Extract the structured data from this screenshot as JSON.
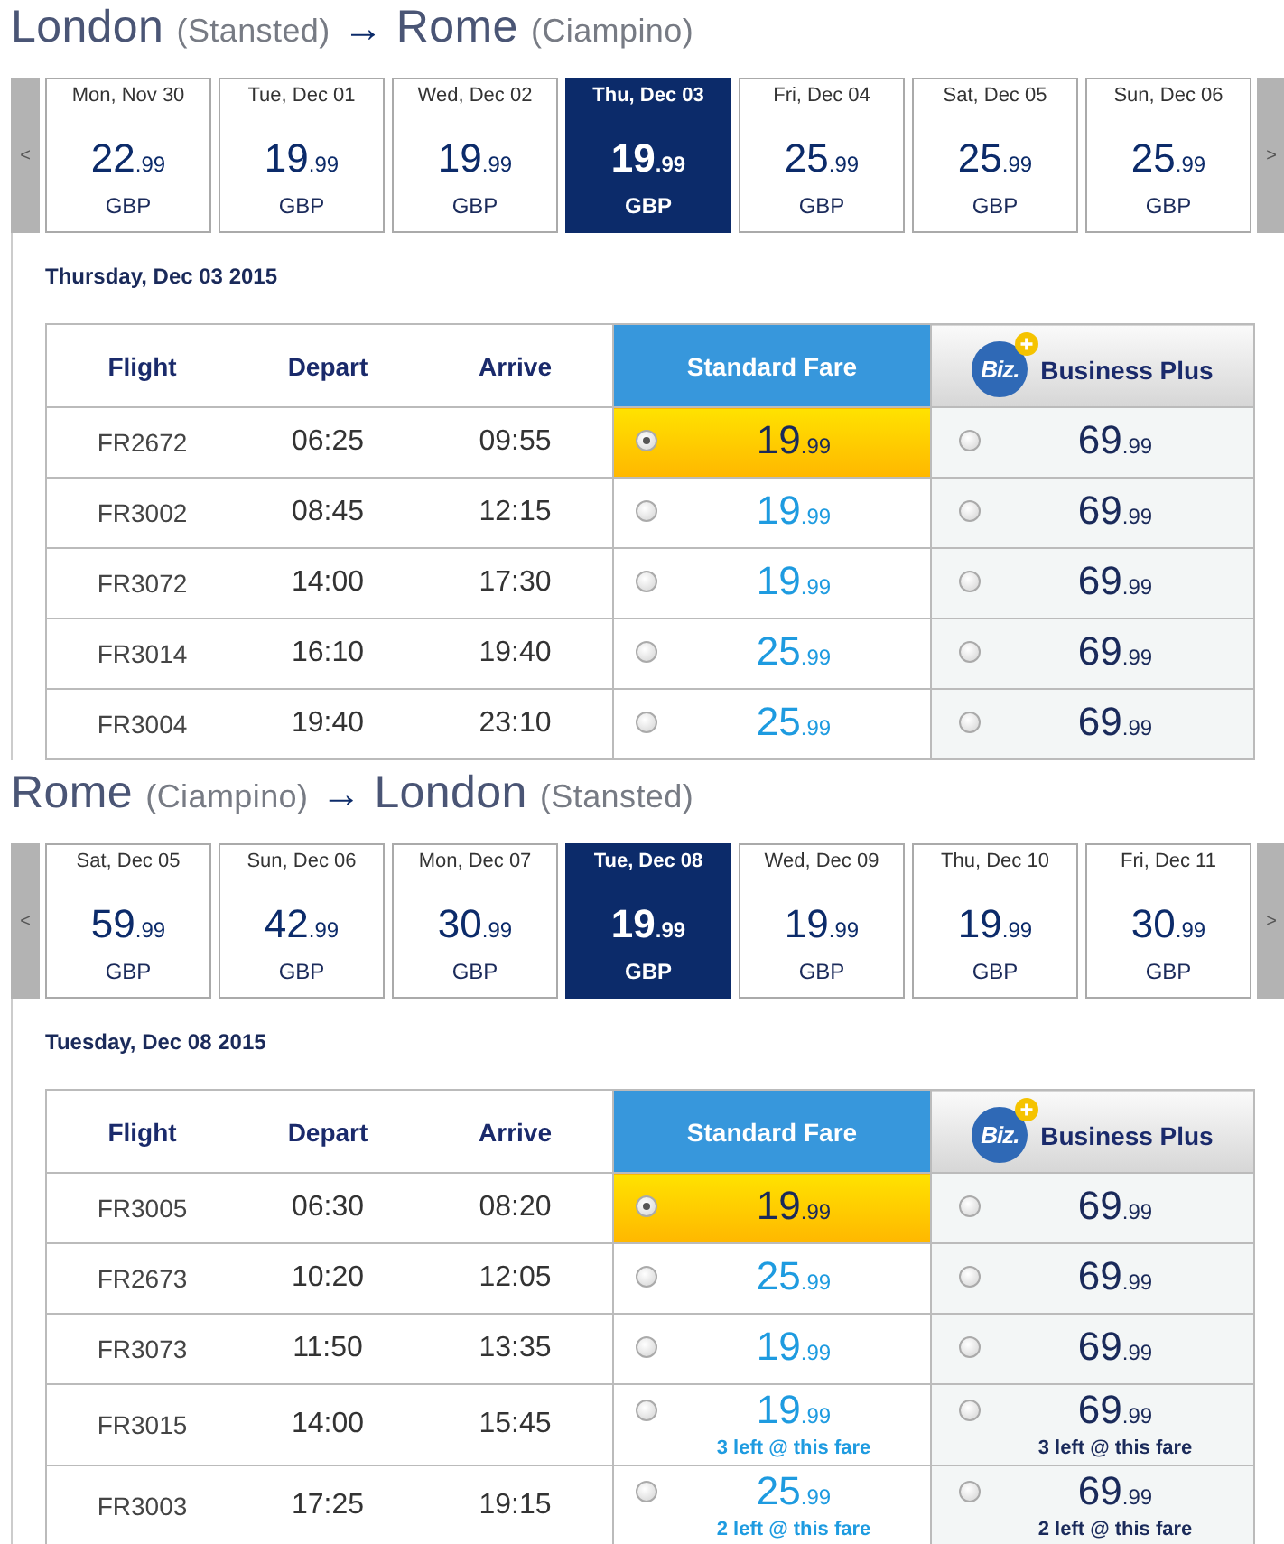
{
  "journeys": [
    {
      "route": {
        "origin": "London",
        "origin_airport": "(Stansted)",
        "arrow": "→",
        "destination": "Rome",
        "destination_airport": "(Ciampino)"
      },
      "date_strip": {
        "prev": "<",
        "next": ">",
        "dates": [
          {
            "day": "Mon, Nov 30",
            "price": "22",
            "cents": ".99",
            "currency": "GBP",
            "selected": false
          },
          {
            "day": "Tue, Dec 01",
            "price": "19",
            "cents": ".99",
            "currency": "GBP",
            "selected": false
          },
          {
            "day": "Wed, Dec 02",
            "price": "19",
            "cents": ".99",
            "currency": "GBP",
            "selected": false
          },
          {
            "day": "Thu, Dec 03",
            "price": "19",
            "cents": ".99",
            "currency": "GBP",
            "selected": true
          },
          {
            "day": "Fri, Dec 04",
            "price": "25",
            "cents": ".99",
            "currency": "GBP",
            "selected": false
          },
          {
            "day": "Sat, Dec 05",
            "price": "25",
            "cents": ".99",
            "currency": "GBP",
            "selected": false
          },
          {
            "day": "Sun, Dec 06",
            "price": "25",
            "cents": ".99",
            "currency": "GBP",
            "selected": false
          }
        ]
      },
      "selected_date": "Thursday, Dec 03 2015",
      "table": {
        "columns": [
          {
            "label": "Flight",
            "kind": "plain"
          },
          {
            "label": "Depart",
            "kind": "plain"
          },
          {
            "label": "Arrive",
            "kind": "plain"
          },
          {
            "label": "Standard Fare",
            "kind": "standard"
          },
          {
            "label": "Business Plus",
            "kind": "business",
            "logo": "Biz."
          }
        ],
        "rows": [
          {
            "flight": "FR2672",
            "depart": "06:25",
            "arrive": "09:55",
            "standard": {
              "price": "19",
              "cents": ".99",
              "selected": true
            },
            "business": {
              "price": "69",
              "cents": ".99",
              "selected": false
            }
          },
          {
            "flight": "FR3002",
            "depart": "08:45",
            "arrive": "12:15",
            "standard": {
              "price": "19",
              "cents": ".99",
              "selected": false
            },
            "business": {
              "price": "69",
              "cents": ".99",
              "selected": false
            }
          },
          {
            "flight": "FR3072",
            "depart": "14:00",
            "arrive": "17:30",
            "standard": {
              "price": "19",
              "cents": ".99",
              "selected": false
            },
            "business": {
              "price": "69",
              "cents": ".99",
              "selected": false
            }
          },
          {
            "flight": "FR3014",
            "depart": "16:10",
            "arrive": "19:40",
            "standard": {
              "price": "25",
              "cents": ".99",
              "selected": false
            },
            "business": {
              "price": "69",
              "cents": ".99",
              "selected": false
            }
          },
          {
            "flight": "FR3004",
            "depart": "19:40",
            "arrive": "23:10",
            "standard": {
              "price": "25",
              "cents": ".99",
              "selected": false
            },
            "business": {
              "price": "69",
              "cents": ".99",
              "selected": false
            }
          }
        ]
      }
    },
    {
      "route": {
        "origin": "Rome",
        "origin_airport": "(Ciampino)",
        "arrow": "→",
        "destination": "London",
        "destination_airport": "(Stansted)"
      },
      "date_strip": {
        "prev": "<",
        "next": ">",
        "dates": [
          {
            "day": "Sat, Dec 05",
            "price": "59",
            "cents": ".99",
            "currency": "GBP",
            "selected": false
          },
          {
            "day": "Sun, Dec 06",
            "price": "42",
            "cents": ".99",
            "currency": "GBP",
            "selected": false
          },
          {
            "day": "Mon, Dec 07",
            "price": "30",
            "cents": ".99",
            "currency": "GBP",
            "selected": false
          },
          {
            "day": "Tue, Dec 08",
            "price": "19",
            "cents": ".99",
            "currency": "GBP",
            "selected": true
          },
          {
            "day": "Wed, Dec 09",
            "price": "19",
            "cents": ".99",
            "currency": "GBP",
            "selected": false
          },
          {
            "day": "Thu, Dec 10",
            "price": "19",
            "cents": ".99",
            "currency": "GBP",
            "selected": false
          },
          {
            "day": "Fri, Dec 11",
            "price": "30",
            "cents": ".99",
            "currency": "GBP",
            "selected": false
          }
        ]
      },
      "selected_date": "Tuesday, Dec 08 2015",
      "table": {
        "columns": [
          {
            "label": "Flight",
            "kind": "plain"
          },
          {
            "label": "Depart",
            "kind": "plain"
          },
          {
            "label": "Arrive",
            "kind": "plain"
          },
          {
            "label": "Standard Fare",
            "kind": "standard"
          },
          {
            "label": "Business Plus",
            "kind": "business",
            "logo": "Biz."
          }
        ],
        "rows": [
          {
            "flight": "FR3005",
            "depart": "06:30",
            "arrive": "08:20",
            "standard": {
              "price": "19",
              "cents": ".99",
              "selected": true
            },
            "business": {
              "price": "69",
              "cents": ".99",
              "selected": false
            }
          },
          {
            "flight": "FR2673",
            "depart": "10:20",
            "arrive": "12:05",
            "standard": {
              "price": "25",
              "cents": ".99",
              "selected": false
            },
            "business": {
              "price": "69",
              "cents": ".99",
              "selected": false
            }
          },
          {
            "flight": "FR3073",
            "depart": "11:50",
            "arrive": "13:35",
            "standard": {
              "price": "19",
              "cents": ".99",
              "selected": false
            },
            "business": {
              "price": "69",
              "cents": ".99",
              "selected": false
            }
          },
          {
            "flight": "FR3015",
            "depart": "14:00",
            "arrive": "15:45",
            "standard": {
              "price": "19",
              "cents": ".99",
              "selected": false,
              "note": "3 left @ this fare"
            },
            "business": {
              "price": "69",
              "cents": ".99",
              "selected": false,
              "note": "3 left @ this fare"
            }
          },
          {
            "flight": "FR3003",
            "depart": "17:25",
            "arrive": "19:15",
            "standard": {
              "price": "25",
              "cents": ".99",
              "selected": false,
              "note": "2 left @ this fare"
            },
            "business": {
              "price": "69",
              "cents": ".99",
              "selected": false,
              "note": "2 left @ this fare"
            }
          }
        ]
      }
    }
  ]
}
